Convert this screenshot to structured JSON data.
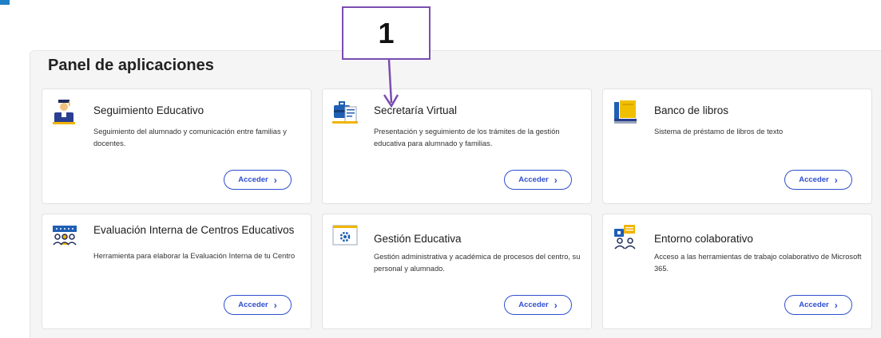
{
  "panel": {
    "title": "Panel de aplicaciones"
  },
  "cards": [
    {
      "title": "Seguimiento Educativo",
      "description": "Seguimiento del alumnado y comunicación entre familias y docentes.",
      "button": "Acceder",
      "icon": "graduate-icon"
    },
    {
      "title": "Secretaría Virtual",
      "description": "Presentación y seguimiento de los trámites de la gestión educativa para alumnado y familias.",
      "button": "Acceder",
      "icon": "briefcase-document-icon"
    },
    {
      "title": "Banco de libros",
      "description": "Sistema de préstamo de libros de texto",
      "button": "Acceder",
      "icon": "books-icon"
    },
    {
      "title": "Evaluación Interna de Centros Educativos",
      "description": "Herramienta para elaborar la Evaluación Interna de tu Centro",
      "button": "Acceder",
      "icon": "group-evaluation-icon"
    },
    {
      "title": "Gestión Educativa",
      "description": "Gestión administrativa y académica de procesos del centro, su personal y alumnado.",
      "button": "Acceder",
      "icon": "gear-screen-icon"
    },
    {
      "title": "Entorno colaborativo",
      "description": "Acceso a las herramientas de trabajo colaborativo de Microsoft 365.",
      "button": "Acceder",
      "icon": "chat-people-icon"
    }
  ],
  "annotation": {
    "label": "1"
  },
  "colors": {
    "accent": "#2f4fcf",
    "annotation_border": "#7a4db0"
  }
}
